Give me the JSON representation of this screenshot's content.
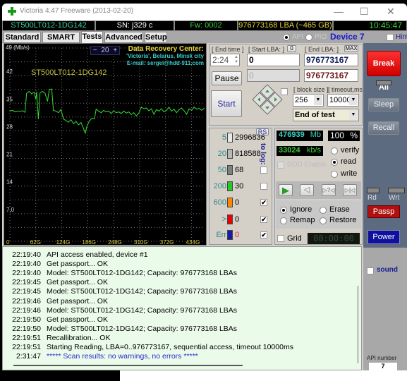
{
  "window": {
    "title": "Victoria 4.47  Freeware (2013-02-20)",
    "minimize": "—",
    "maximize": "☐",
    "close": "✕"
  },
  "infobar": {
    "model": "ST500LT012-1DG142",
    "serial": "SN: j329 c",
    "firmware": "Fw: 0002",
    "capacity": "976773168 LBA (~465 GB)",
    "clock": "10:45:47"
  },
  "tabs": [
    {
      "label": "Standard"
    },
    {
      "label": "SMART"
    },
    {
      "label": "Tests",
      "active": true
    },
    {
      "label": "Advanced"
    },
    {
      "label": "Setup"
    }
  ],
  "access": {
    "api": "API",
    "pio": "PIO",
    "selected": "API",
    "device": "Device 7",
    "hints": "Hints"
  },
  "graph": {
    "unit_label": "49 (Mb/s)",
    "zoom_minus": "−",
    "zoom_value": "20",
    "zoom_plus": "+",
    "drive_label": "ST500LT012-1DG142",
    "banner": {
      "title": "Data Recovery Center:",
      "line1": "'Victoria', Belarus, Minsk city",
      "line2": "E-mail: sergei@hdd-911.com"
    },
    "y_ticks": [
      "42",
      "35",
      "28",
      "21",
      "14",
      "7,0"
    ],
    "x_ticks": [
      "0",
      "62G",
      "124G",
      "186G",
      "248G",
      "310G",
      "372G",
      "434G"
    ],
    "ylim": [
      0,
      49
    ],
    "xlim": [
      0,
      465
    ],
    "grid": true,
    "line_color": "#33dd33",
    "points": [
      [
        0,
        33
      ],
      [
        6,
        33.2
      ],
      [
        12,
        32.8
      ],
      [
        18,
        33
      ],
      [
        24,
        32.9
      ],
      [
        30,
        33.1
      ],
      [
        36,
        32.7
      ],
      [
        40,
        37.5
      ],
      [
        46,
        38
      ],
      [
        52,
        37.4
      ],
      [
        58,
        37.8
      ],
      [
        62,
        36
      ],
      [
        64,
        37.9
      ],
      [
        68,
        31
      ],
      [
        72,
        37.6
      ],
      [
        78,
        38
      ],
      [
        84,
        37.5
      ],
      [
        90,
        35.5
      ],
      [
        94,
        38.5
      ],
      [
        100,
        38.6
      ],
      [
        104,
        33.2
      ],
      [
        110,
        33
      ],
      [
        116,
        32.6
      ],
      [
        122,
        33.4
      ],
      [
        128,
        31
      ],
      [
        134,
        30.6
      ],
      [
        140,
        30.2
      ],
      [
        146,
        30.8
      ],
      [
        152,
        29.8
      ],
      [
        158,
        30.4
      ],
      [
        164,
        29.5
      ],
      [
        170,
        30.1
      ],
      [
        176,
        28.6
      ],
      [
        180,
        27.4
      ],
      [
        184,
        29.2
      ],
      [
        190,
        30.5
      ],
      [
        196,
        31.2
      ],
      [
        202,
        31
      ],
      [
        206,
        33.5
      ],
      [
        212,
        33
      ],
      [
        218,
        32.6
      ],
      [
        224,
        33.2
      ],
      [
        230,
        32.8
      ],
      [
        236,
        33
      ],
      [
        242,
        32.4
      ],
      [
        248,
        33.1
      ],
      [
        254,
        32.6
      ],
      [
        260,
        32.8
      ],
      [
        266,
        32.4
      ],
      [
        272,
        33
      ],
      [
        278,
        32.5
      ],
      [
        284,
        32.8
      ],
      [
        290,
        32.1
      ],
      [
        296,
        32.6
      ],
      [
        302,
        31.8
      ],
      [
        308,
        32.5
      ],
      [
        314,
        34
      ],
      [
        320,
        33.6
      ],
      [
        326,
        33.8
      ],
      [
        332,
        33.1
      ],
      [
        338,
        33.6
      ],
      [
        344,
        32.2
      ],
      [
        350,
        33.4
      ],
      [
        356,
        33
      ],
      [
        362,
        33.6
      ],
      [
        368,
        32.8
      ],
      [
        374,
        33.2
      ],
      [
        380,
        34
      ],
      [
        386,
        33
      ],
      [
        392,
        33.5
      ],
      [
        398,
        32.6
      ],
      [
        404,
        33.3
      ],
      [
        410,
        33.8
      ],
      [
        416,
        33.1
      ],
      [
        422,
        32.2
      ],
      [
        428,
        33.6
      ],
      [
        434,
        33.2
      ],
      [
        440,
        34
      ],
      [
        446,
        33.5
      ],
      [
        452,
        33.7
      ],
      [
        458,
        33.2
      ],
      [
        465,
        33.8
      ]
    ]
  },
  "controls": {
    "end_time_label": "[ End time ]",
    "end_time": "2:24",
    "start_lba_label": "[ Start LBA: ]",
    "start_lba_zero": "0",
    "start_lba": "0",
    "end_lba_label": "[ End LBA: ]",
    "end_lba_max": "MAX",
    "end_lba": "976773167",
    "current_lba": "0",
    "end_lba_current": "976773167",
    "pause": "Pause",
    "start": "Start",
    "block_size_label": "[ block size ]",
    "block_size": "256",
    "timeout_label": "[ timeout,ms ]",
    "timeout": "10000",
    "end_action": "End of test"
  },
  "stats": {
    "rs": "RS",
    "to_log": "to log:",
    "rows": [
      {
        "label": "5",
        "count": "2996836",
        "color": "#e8e8e8",
        "log": null
      },
      {
        "label": "20",
        "count": "818588",
        "color": "#b8b8b8",
        "log": null
      },
      {
        "label": "50",
        "count": "68",
        "color": "#808080",
        "log": false
      },
      {
        "label": "200",
        "count": "30",
        "color": "#22cc22",
        "log": false
      },
      {
        "label": "600",
        "count": "0",
        "color": "#ff8800",
        "log": true
      },
      {
        "label": ">",
        "count": "0",
        "color": "#ee0000",
        "log": true
      },
      {
        "label": "Err",
        "count": "0",
        "color": "#1a1aaa",
        "log": true
      }
    ]
  },
  "status": {
    "megabytes": "476939",
    "mb_unit": "Mb",
    "percent": "100",
    "percent_unit": "%",
    "speed": "33024",
    "speed_unit": "kb/s",
    "ddd": "DDD Enable",
    "verify": "verify",
    "read": "read",
    "write": "write",
    "mode": "read",
    "ignore": "Ignore",
    "erase": "Erase",
    "remap": "Remap",
    "restore": "Restore",
    "action": "Ignore",
    "grid": "Grid",
    "timer": "00:00:00"
  },
  "right": {
    "break_all": "Break All",
    "sleep": "Sleep",
    "recall": "Recall",
    "rd": "Rd",
    "wrt": "Wrt",
    "passp": "Passp",
    "power": "Power",
    "sound": "sound",
    "api_number_label": "API number",
    "api_number": "7"
  },
  "log": [
    {
      "time": "22:19:40",
      "msg": "API access enabled, device #1"
    },
    {
      "time": "22:19:40",
      "msg": "Get passport... OK"
    },
    {
      "time": "22:19:40",
      "msg": "Model: ST500LT012-1DG142; Capacity: 976773168 LBAs"
    },
    {
      "time": "22:19:45",
      "msg": "Get passport... OK"
    },
    {
      "time": "22:19:45",
      "msg": "Model: ST500LT012-1DG142; Capacity: 976773168 LBAs"
    },
    {
      "time": "22:19:46",
      "msg": "Get passport... OK"
    },
    {
      "time": "22:19:46",
      "msg": "Model: ST500LT012-1DG142; Capacity: 976773168 LBAs"
    },
    {
      "time": "22:19:50",
      "msg": "Get passport... OK"
    },
    {
      "time": "22:19:50",
      "msg": "Model: ST500LT012-1DG142; Capacity: 976773168 LBAs"
    },
    {
      "time": "22:19:51",
      "msg": "Recallibration... OK"
    },
    {
      "time": "22:19:51",
      "msg": "Starting Reading, LBA=0..976773167, sequential access, timeout 10000ms"
    },
    {
      "time": "2:31:47",
      "msg": "***** Scan results: no warnings, no errors *****",
      "highlight": true
    }
  ],
  "colors": {
    "accent_red": "#e01010",
    "power_blue": "#1010a0",
    "log_bg": "#eafbea",
    "panel": "#5d6b80"
  }
}
